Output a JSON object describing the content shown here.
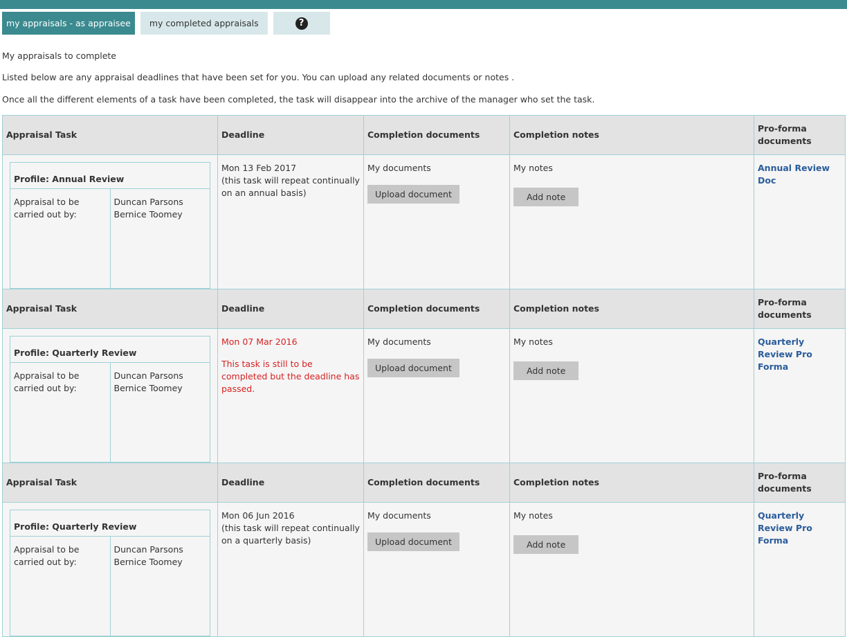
{
  "tabs": {
    "as_appraisee": "my appraisals - as appraisee",
    "completed": "my completed appraisals",
    "help": "?"
  },
  "intro": {
    "heading": "My appraisals to complete",
    "line1": "Listed below are any appraisal deadlines that have been set for you. You can upload any related documents or notes .",
    "line2": "Once all the different elements of a task have been completed, the task will disappear into the archive of the manager who set the task."
  },
  "headers": {
    "task": "Appraisal Task",
    "deadline": "Deadline",
    "docs": "Completion documents",
    "notes": "Completion notes",
    "proforma": "Pro-forma documents"
  },
  "common": {
    "carried_out_label": "Appraisal to be carried out by:",
    "my_documents": "My documents",
    "upload_label": "Upload document",
    "my_notes": "My notes",
    "add_note_label": "Add note"
  },
  "tasks": [
    {
      "profile": "Profile: Annual Review",
      "appraiser": "Duncan Parsons Bernice Toomey",
      "deadline": "Mon 13 Feb 2017",
      "deadline_note": "(this task will repeat continually on an annual basis)",
      "proforma": "Annual Review Doc"
    },
    {
      "profile": "Profile: Quarterly Review",
      "appraiser": "Duncan Parsons Bernice Toomey",
      "deadline": "Mon 07 Mar 2016",
      "deadline_note": "This task is still to be completed but the deadline has passed.",
      "proforma": "Quarterly Review Pro Forma"
    },
    {
      "profile": "Profile: Quarterly Review",
      "appraiser": "Duncan Parsons Bernice Toomey",
      "deadline": "Mon 06 Jun 2016",
      "deadline_note": "(this task will repeat continually on a quarterly basis)",
      "proforma": "Quarterly Review Pro Forma"
    }
  ],
  "colors": {
    "accent": "#3a8a8f",
    "tab_inactive": "#d8e8ea",
    "overdue": "#d62222",
    "link": "#2a5c9a"
  }
}
